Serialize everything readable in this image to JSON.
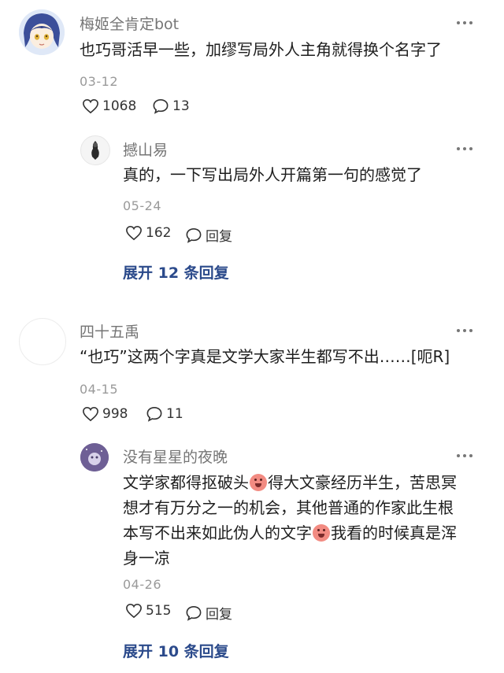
{
  "comments": [
    {
      "username": "梅姬全肯定bot",
      "text": "也巧哥活早一些，加缪写局外人主角就得换个名字了",
      "date": "03-12",
      "likes": "1068",
      "replies": "13",
      "reply": {
        "username": "撼山易",
        "text": "真的，一下写出局外人开篇第一句的感觉了",
        "date": "05-24",
        "likes": "162",
        "reply_label": "回复"
      },
      "expand_label": "展开 12 条回复"
    },
    {
      "username": "四十五禹",
      "text": "“也巧”这两个字真是文学大家半生都写不出……[呃R]",
      "date": "04-15",
      "likes": "998",
      "replies": "11",
      "reply": {
        "username": "没有星星的夜晚",
        "text_lines": [
          "文学家都得抠破头",
          "得大文豪经历半生，苦思冥",
          "想才有万分之一的机会，其他普通的作家此生根",
          "本写不出来如此伪人的文字",
          "我看的时候真是浑",
          "身一凉"
        ],
        "date": "04-26",
        "likes": "515",
        "reply_label": "回复"
      },
      "expand_label": "展开 10 条回复"
    }
  ],
  "icons": {
    "like": "heart-outline-icon",
    "comment": "speech-bubble-icon",
    "more": "more-dots-icon",
    "emoji": "crying-face-emoji-icon"
  },
  "colors": {
    "expand_link": "#2b4a8b",
    "username": "#757575",
    "date": "#9a9a9a"
  }
}
